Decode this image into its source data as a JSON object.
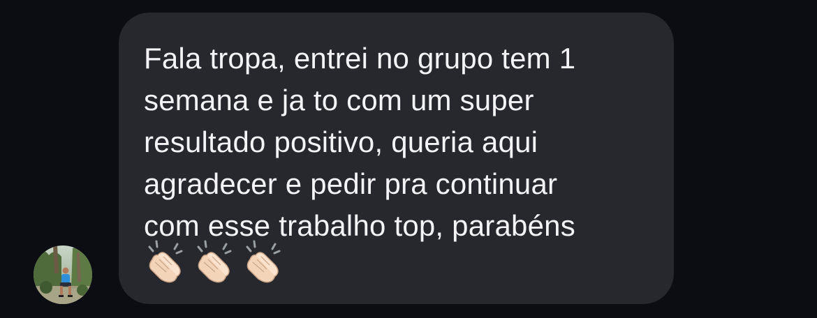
{
  "message": {
    "text": "Fala tropa, entrei no grupo tem 1\nsemana e ja to com um super\nresultado positivo, queria aqui\nagradecer e pedir pra continuar\ncom esse trabalho top, parabéns",
    "reactions": [
      "clapping-hands-icon",
      "clapping-hands-icon",
      "clapping-hands-icon"
    ]
  },
  "sender": {
    "avatar_icon": "profile-photo"
  },
  "colors": {
    "background": "#0b0d12",
    "bubble": "#26282d",
    "text": "#f4f4f6",
    "skin": "#f6dcc4"
  }
}
